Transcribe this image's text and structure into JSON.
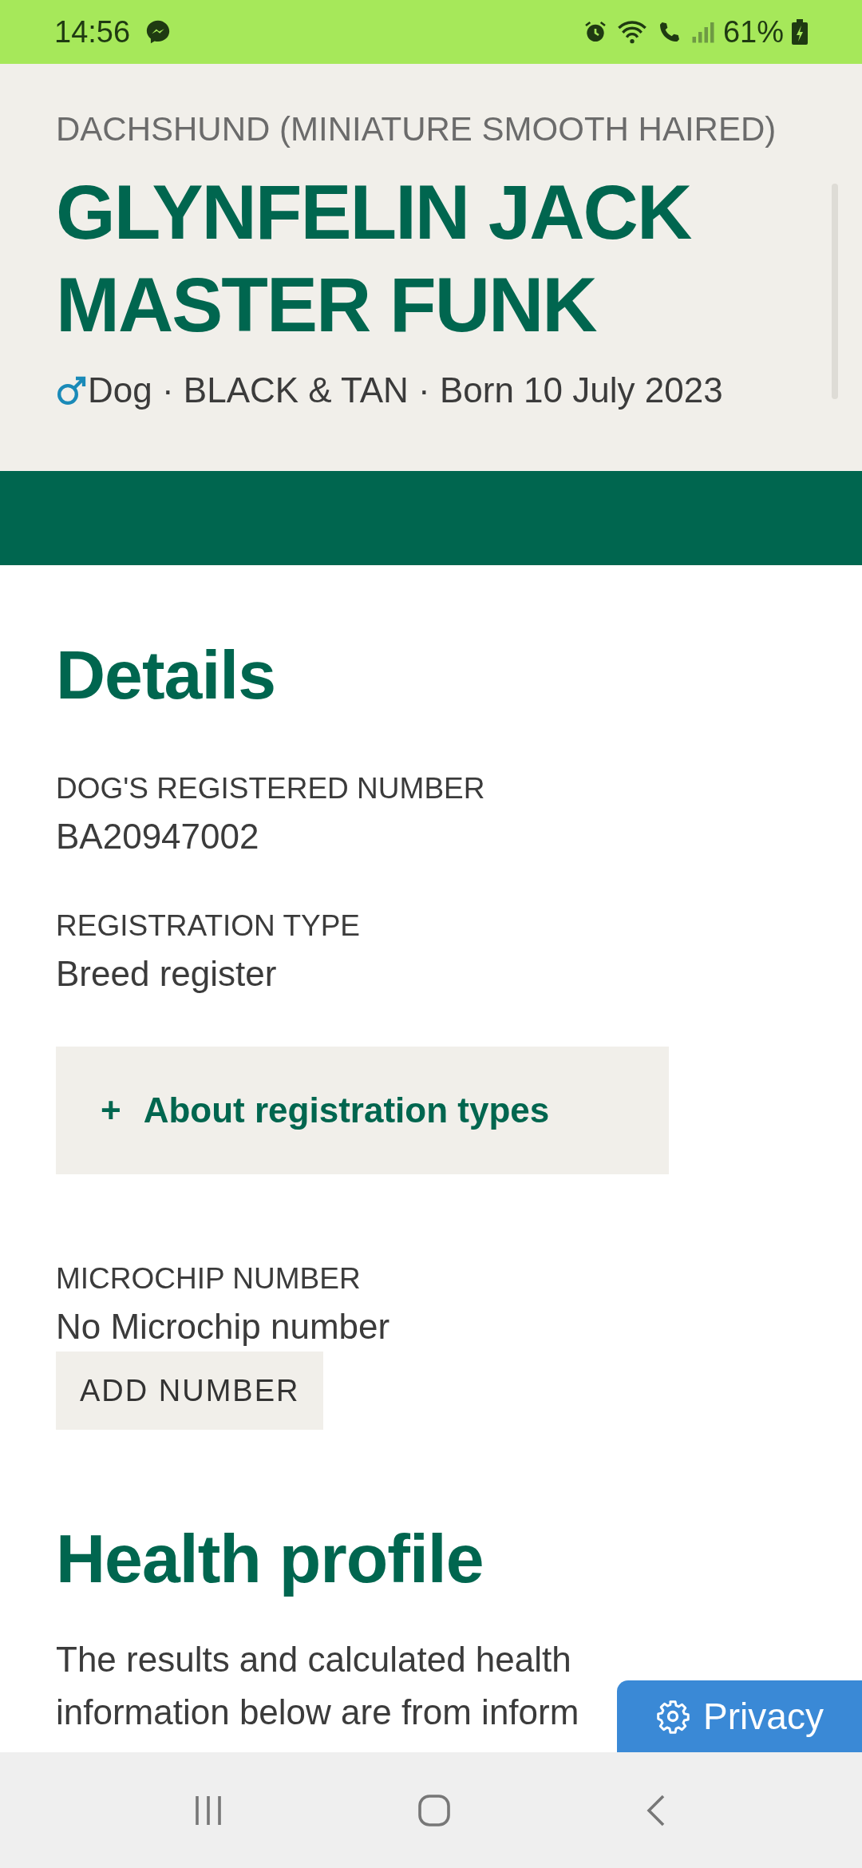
{
  "status_bar": {
    "time": "14:56",
    "battery": "61%"
  },
  "header": {
    "breed": "DACHSHUND (MINIATURE SMOOTH HAIRED)",
    "name": "GLYNFELIN JACK MASTER FUNK",
    "meta": "Dog · BLACK & TAN · Born 10 July 2023"
  },
  "details": {
    "heading": "Details",
    "fields": [
      {
        "label": "DOG'S REGISTERED NUMBER",
        "value": "BA20947002"
      },
      {
        "label": "REGISTRATION TYPE",
        "value": "Breed register"
      }
    ],
    "expander": {
      "icon": "+",
      "label": "About registration types",
      "expanded": false
    },
    "microchip": {
      "label": "MICROCHIP NUMBER",
      "value": "No Microchip number",
      "button": "ADD NUMBER"
    }
  },
  "health": {
    "heading": "Health profile",
    "text": "The results and calculated health information below are from inform"
  },
  "privacy_button": "Privacy"
}
